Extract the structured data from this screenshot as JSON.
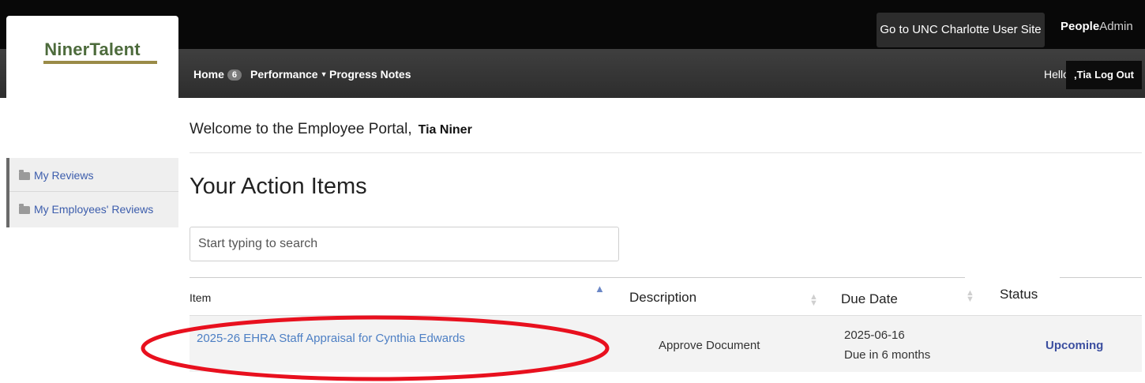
{
  "brand": {
    "logo": "NinerTalent",
    "user_site_button": "Go to UNC Charlotte User Site",
    "people_bold": "People",
    "admin_regular": "Admin"
  },
  "nav": {
    "home": "Home",
    "home_badge": "6",
    "performance": "Performance",
    "progress_notes": "Progress Notes",
    "hello": "Hello,",
    "user_name": ",Tia",
    "logout": "Log Out"
  },
  "welcome": {
    "text": "Welcome to the Employee Portal,",
    "name": "Tia Niner"
  },
  "sidebar": {
    "items": [
      {
        "label": "My Reviews"
      },
      {
        "label": "My Employees' Reviews"
      }
    ]
  },
  "actions": {
    "title": "Your Action Items",
    "search_placeholder": "Start typing to search"
  },
  "table": {
    "columns": [
      "Item",
      "Description",
      "Due Date",
      "Status"
    ],
    "rows": [
      {
        "item": "2025-26 EHRA Staff Appraisal for Cynthia Edwards",
        "description": "Approve Document",
        "due_date": "2025-06-16",
        "due_relative": "Due in 6 months",
        "status": "Upcoming"
      }
    ]
  },
  "colors": {
    "topbar": "#080808",
    "navbar": "#383838",
    "logo_green": "#4d6b3c",
    "logo_accent": "#9a8b47",
    "link_blue": "#4d7fc4",
    "status_blue": "#3c4fa0",
    "highlight_red": "#e8101e"
  }
}
